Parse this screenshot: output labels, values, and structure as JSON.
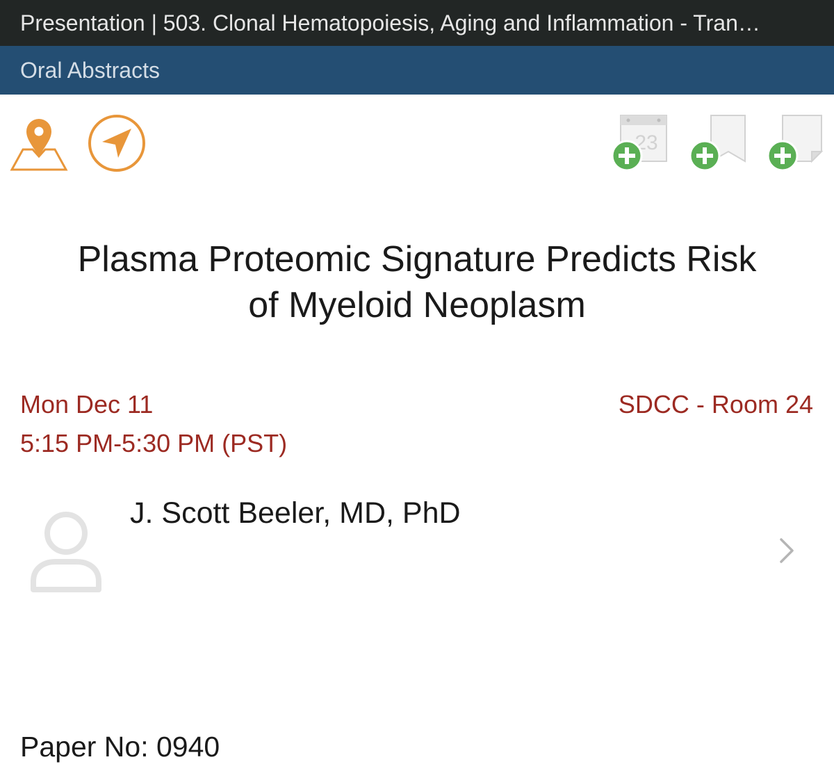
{
  "header": {
    "title": "Presentation | 503. Clonal Hematopoiesis, Aging and Inflammation -  Tran…",
    "section": "Oral Abstracts"
  },
  "actions": {
    "icons": [
      "map-pin-icon",
      "navigate-icon",
      "add-calendar-icon",
      "add-bookmark-icon",
      "add-note-icon"
    ],
    "calendar_day": "23"
  },
  "presentation": {
    "title_line1": "Plasma Proteomic Signature Predicts Risk",
    "title_line2": "of Myeloid Neoplasm",
    "date": "Mon Dec 11",
    "time": "5:15 PM-5:30 PM (PST)",
    "location": "SDCC - Room 24",
    "paper_no": "Paper No: 0940"
  },
  "speaker": {
    "name": "J. Scott Beeler, MD, PhD"
  },
  "colors": {
    "title_bar": "#222625",
    "section_bar": "#244e73",
    "accent_orange": "#e8963a",
    "accent_green": "#5aaf54",
    "meta_red": "#9c2a22"
  }
}
